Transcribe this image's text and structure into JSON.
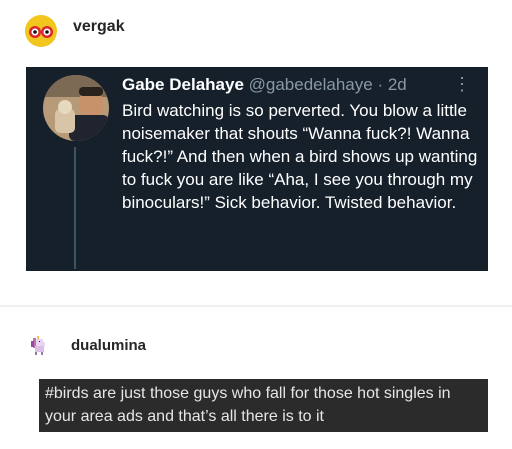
{
  "post1": {
    "username": "vergak",
    "avatar_icon": "eyes-icon",
    "tweet": {
      "display_name": "Gabe Delahaye",
      "handle_time": "@gabedelahaye · 2d",
      "more_icon": "more-vertical-icon",
      "text": "Bird watching is so perverted. You blow a little noisemaker that shouts “Wanna fuck?! Wanna fuck?!” And then when a bird shows up wanting to fuck you are like “Aha, I see you through my binoculars!” Sick behavior. Twisted behavior."
    }
  },
  "post2": {
    "username": "dualumina",
    "avatar_icon": "pixel-unicorn-icon",
    "tag_text": "#birds are just those guys who fall for those hot singles in your area ads and that’s all there is to it"
  },
  "colors": {
    "tweet_bg": "#15202b",
    "tweet_secondary": "#8899a6",
    "tag_bg": "#2b2b2b",
    "avatar_yellow": "#f2c51f",
    "avatar_red": "#d9272e"
  }
}
